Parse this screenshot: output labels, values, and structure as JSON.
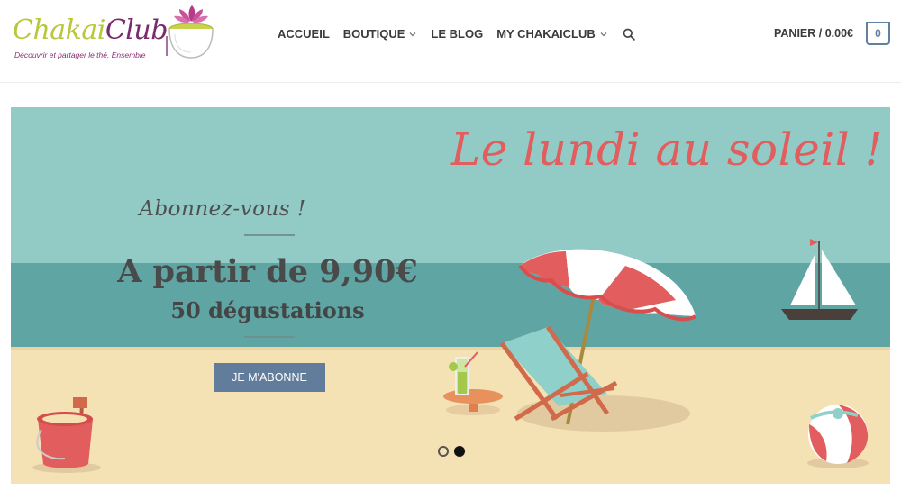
{
  "brand": {
    "logo_word1": "Chakai",
    "logo_word2": "Club",
    "tagline": "Découvrir et partager le thé. Ensemble"
  },
  "nav": {
    "items": [
      {
        "label": "ACCUEIL",
        "has_dropdown": false
      },
      {
        "label": "BOUTIQUE",
        "has_dropdown": true
      },
      {
        "label": "LE BLOG",
        "has_dropdown": false
      },
      {
        "label": "MY CHAKAICLUB",
        "has_dropdown": true
      }
    ],
    "search_icon": "search-icon"
  },
  "cart": {
    "label": "PANIER / 0.00€",
    "count": "0"
  },
  "hero": {
    "headline": "Le lundi au soleil !",
    "promo_tagline": "Abonnez-vous !",
    "price": "A partir de 9,90€",
    "subtitle": "50 dégustations",
    "cta_label": "JE M'ABONNE",
    "slides_total": 2,
    "slide_active": 2
  },
  "colors": {
    "sky": "#92cbc5",
    "sea": "#5fa5a4",
    "sand": "#f4e1b4",
    "accent_red": "#e25d5d",
    "button": "#627d9b",
    "logo_green": "#b9c73a",
    "logo_purple": "#7b2a6b"
  }
}
